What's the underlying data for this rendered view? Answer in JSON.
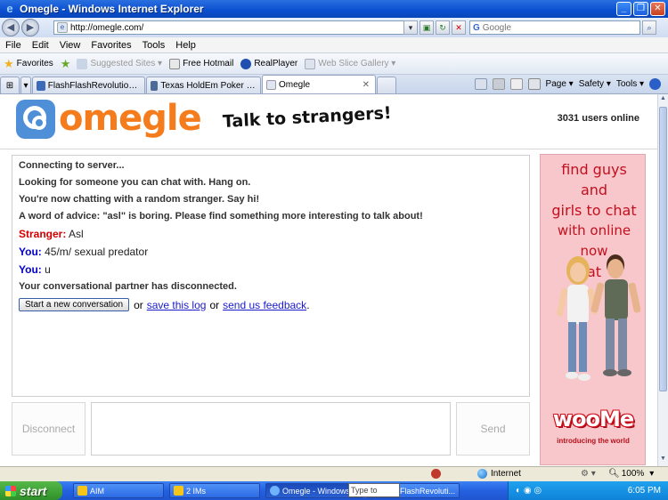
{
  "window": {
    "title": "Omegle - Windows Internet Explorer",
    "min_glyph": "_",
    "max_glyph": "❐",
    "close_glyph": "✕"
  },
  "address": {
    "url": "http://omegle.com/",
    "search_placeholder": "Google",
    "search_engine": "Google"
  },
  "menu": [
    "File",
    "Edit",
    "View",
    "Favorites",
    "Tools",
    "Help"
  ],
  "favorites_bar": {
    "favorites_label": "Favorites",
    "items": [
      "Suggested Sites ▾",
      "Free Hotmail",
      "RealPlayer",
      "Web Slice Gallery ▾"
    ]
  },
  "tabs": [
    {
      "label": "FlashFlashRevolution.com"
    },
    {
      "label": "Texas HoldEm Poker on Face..."
    },
    {
      "label": "Omegle"
    }
  ],
  "command_bar": [
    "Page ▾",
    "Safety ▾",
    "Tools ▾"
  ],
  "omegle": {
    "logo": "omegle",
    "tagline": "Talk to strangers!",
    "users_online": "3031 users online",
    "log": {
      "sys1": "Connecting to server...",
      "sys2": "Looking for someone you can chat with. Hang on.",
      "sys3": "You're now chatting with a random stranger. Say hi!",
      "sys4": "A word of advice: \"asl\" is boring. Please find something more interesting to talk about!",
      "m1_who": "Stranger:",
      "m1_text": "Asl",
      "m2_who": "You:",
      "m2_text": "45/m/ sexual predator",
      "m3_who": "You:",
      "m3_text": "u",
      "sys5": "Your conversational partner has disconnected."
    },
    "actions": {
      "new_conversation": "Start a new conversation",
      "or1": "or",
      "save_log": "save this log",
      "or2": "or",
      "feedback": "send us feedback",
      "period": "."
    },
    "disconnect": "Disconnect",
    "send": "Send"
  },
  "ad": {
    "line1": "find guys and",
    "line2": "girls to chat",
    "line3": "with online now",
    "line4": "at",
    "brand": "wooMe",
    "sub": "introducing the world"
  },
  "status": {
    "zone": "Internet",
    "zoom": "100%"
  },
  "taskbar": {
    "start": "start",
    "tasks": [
      "AIM",
      "2 IMs",
      "Omegle - Windows ...",
      "FlashFlashRevoluti..."
    ],
    "search_placeholder": "Type to search",
    "clock": "6:05 PM"
  }
}
